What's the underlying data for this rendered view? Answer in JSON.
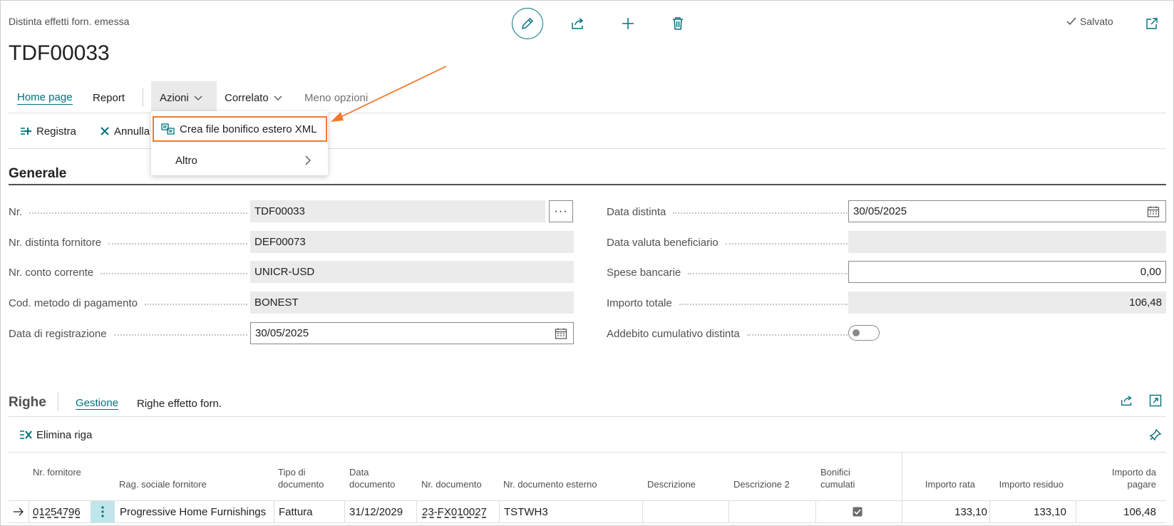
{
  "header": {
    "caption": "Distinta effetti forn. emessa",
    "title": "TDF00033",
    "saved_label": "Salvato"
  },
  "menu": {
    "home": "Home page",
    "report": "Report",
    "azioni": "Azioni",
    "correlato": "Correlato",
    "meno_opzioni": "Meno opzioni"
  },
  "actions": {
    "registra": "Registra",
    "annulla": "Annulla"
  },
  "dropdown": {
    "item1": "Crea file bonifico estero XML",
    "item2": "Altro"
  },
  "section": {
    "title": "Generale"
  },
  "fields_left": [
    {
      "label": "Nr.",
      "value": "TDF00033"
    },
    {
      "label": "Nr. distinta fornitore",
      "value": "DEF00073"
    },
    {
      "label": "Nr. conto corrente",
      "value": "UNICR-USD"
    },
    {
      "label": "Cod. metodo di pagamento",
      "value": "BONEST"
    },
    {
      "label": "Data di registrazione",
      "value": "30/05/2025"
    }
  ],
  "fields_right": [
    {
      "label": "Data distinta",
      "value": "30/05/2025"
    },
    {
      "label": "Data valuta beneficiario",
      "value": ""
    },
    {
      "label": "Spese bancarie",
      "value": "0,00"
    },
    {
      "label": "Importo totale",
      "value": "106,48"
    },
    {
      "label": "Addebito cumulativo distinta",
      "value": ""
    }
  ],
  "lines": {
    "title": "Righe",
    "tab_gestione": "Gestione",
    "tab_righe": "Righe effetto forn.",
    "elimina_riga": "Elimina riga",
    "columns": [
      "Nr. fornitore",
      "Rag. sociale fornitore",
      "Tipo di documento",
      "Data documento",
      "Nr. documento",
      "Nr. documento esterno",
      "Descrizione",
      "Descrizione 2",
      "Bonifici cumulati",
      "Importo rata",
      "Importo residuo",
      "Importo da pagare"
    ],
    "row": {
      "nr_fornitore": "01254796",
      "rag_sociale": "Progressive Home Furnishings",
      "tipo_doc": "Fattura",
      "data_doc": "31/12/2029",
      "nr_doc": "23-FX010027",
      "nr_doc_esterno": "TSTWH3",
      "descrizione": "",
      "descrizione2": "",
      "bonifici_cumulati": true,
      "importo_rata": "133,10",
      "importo_residuo": "133,10",
      "importo_da_pagare": "106,48"
    }
  },
  "colors": {
    "accent": "#00707c",
    "highlight": "#f4792e"
  }
}
